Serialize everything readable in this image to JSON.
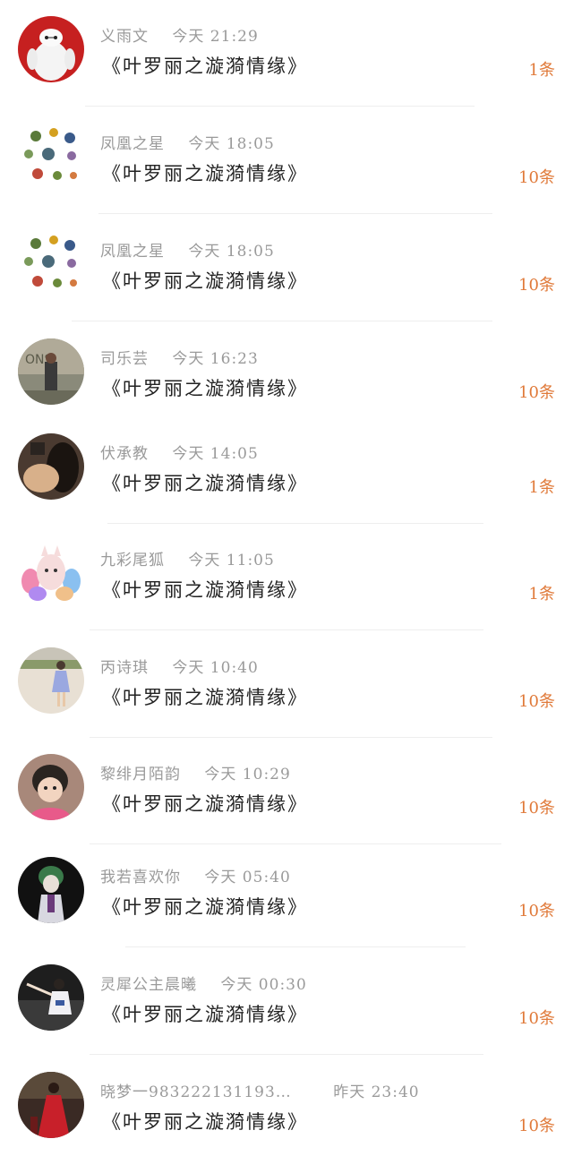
{
  "items": [
    {
      "name": "义雨文",
      "time": "今天  21:29",
      "title": "《叶罗丽之漩漪情缘》",
      "count": "1条",
      "avatar_icon": "baymax-avatar-icon",
      "avatar_bg": "#c62020"
    },
    {
      "name": "凤凰之星",
      "time": "今天  18:05",
      "title": "《叶罗丽之漩漪情缘》",
      "count": "10条",
      "avatar_icon": "floral-avatar-icon",
      "avatar_bg": "#ffffff"
    },
    {
      "name": "凤凰之星",
      "time": "今天  18:05",
      "title": "《叶罗丽之漩漪情缘》",
      "count": "10条",
      "avatar_icon": "floral-avatar-icon",
      "avatar_bg": "#ffffff"
    },
    {
      "name": "司乐芸",
      "time": "今天  16:23",
      "title": "《叶罗丽之漩漪情缘》",
      "count": "10条",
      "avatar_icon": "graffiti-photo-avatar-icon",
      "avatar_bg": "#8a8a7a"
    },
    {
      "name": "伏承教",
      "time": "今天  14:05",
      "title": "《叶罗丽之漩漪情缘》",
      "count": "1条",
      "avatar_icon": "girl-photo-avatar-icon",
      "avatar_bg": "#4a3a30"
    },
    {
      "name": "九彩尾狐",
      "time": "今天  11:05",
      "title": "《叶罗丽之漩漪情缘》",
      "count": "1条",
      "avatar_icon": "fox-avatar-icon",
      "avatar_bg": "#f6eef6"
    },
    {
      "name": "丙诗琪",
      "time": "今天  10:40",
      "title": "《叶罗丽之漩漪情缘》",
      "count": "10条",
      "avatar_icon": "girl-beach-avatar-icon",
      "avatar_bg": "#e8e0d4"
    },
    {
      "name": "黎绯月陌韵",
      "time": "今天  10:29",
      "title": "《叶罗丽之漩漪情缘》",
      "count": "10条",
      "avatar_icon": "child-photo-avatar-icon",
      "avatar_bg": "#a8887a"
    },
    {
      "name": "我若喜欢你",
      "time": "今天  05:40",
      "title": "《叶罗丽之漩漪情缘》",
      "count": "10条",
      "avatar_icon": "anime-character-avatar-icon",
      "avatar_bg": "#111111"
    },
    {
      "name": "灵犀公主晨曦",
      "time": "今天  00:30",
      "title": "《叶罗丽之漩漪情缘》",
      "count": "10条",
      "avatar_icon": "girl-dance-avatar-icon",
      "avatar_bg": "#222222"
    },
    {
      "name": "晓梦一983222131193…",
      "time": "昨天  23:40",
      "title": "《叶罗丽之漩漪情缘》",
      "count": "10条",
      "avatar_icon": "girl-red-dress-avatar-icon",
      "avatar_bg": "#3a2a24"
    }
  ],
  "colors": {
    "count": "#e07a3a",
    "meta": "#9a9a9a",
    "title": "#222222"
  }
}
